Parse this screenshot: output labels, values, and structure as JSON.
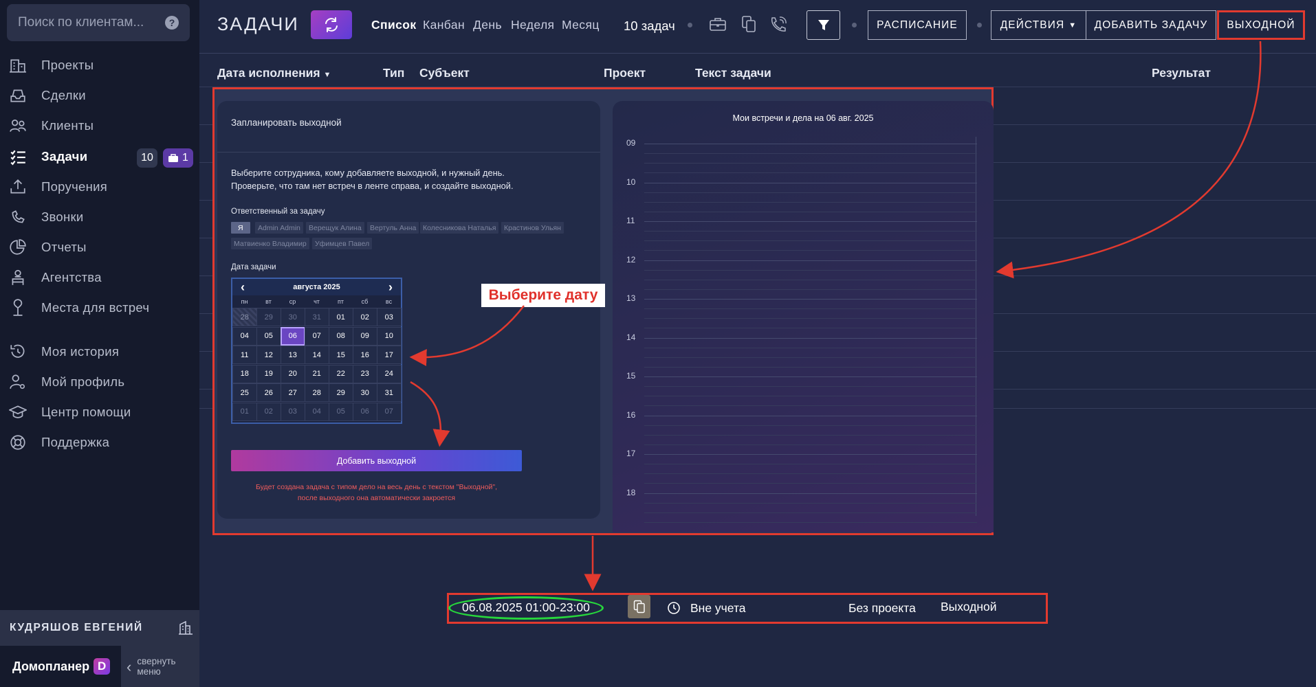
{
  "sidebar": {
    "search_placeholder": "Поиск по клиентам...",
    "help_glyph": "?",
    "items": [
      {
        "label": "Проекты",
        "icon": "buildings-icon"
      },
      {
        "label": "Сделки",
        "icon": "inbox-icon"
      },
      {
        "label": "Клиенты",
        "icon": "users-icon"
      },
      {
        "label": "Задачи",
        "icon": "task-list-icon",
        "active": true
      },
      {
        "label": "Поручения",
        "icon": "upload-tray-icon"
      },
      {
        "label": "Звонки",
        "icon": "phone-icon"
      },
      {
        "label": "Отчеты",
        "icon": "pie-chart-icon"
      },
      {
        "label": "Агентства",
        "icon": "agency-icon"
      },
      {
        "label": "Места для встреч",
        "icon": "location-icon"
      },
      {
        "label": "Моя история",
        "icon": "history-icon"
      },
      {
        "label": "Мой профиль",
        "icon": "user-settings-icon"
      },
      {
        "label": "Центр помощи",
        "icon": "graduation-cap-icon"
      },
      {
        "label": "Поддержка",
        "icon": "lifebuoy-icon"
      }
    ],
    "tasks_count": "10",
    "tasks_brief_count": "1",
    "user_name": "КУДРЯШОВ ЕВГЕНИЙ",
    "brand": "Домопланер",
    "brand_logo": "D",
    "collapse_line1": "свернуть",
    "collapse_line2": "меню"
  },
  "topbar": {
    "title": "ЗАДАЧИ",
    "tabs": [
      "Список",
      "Канбан",
      "День",
      "Неделя",
      "Месяц"
    ],
    "active_tab": "Список",
    "task_count": "10 задач",
    "schedule_btn": "РАСПИСАНИЕ",
    "actions_btn": "ДЕЙСТВИЯ",
    "add_task_btn": "ДОБАВИТЬ ЗАДАЧУ",
    "day_off_btn": "ВЫХОДНОЙ"
  },
  "table": {
    "columns": [
      "Дата исполнения",
      "Тип",
      "Субъект",
      "Проект",
      "Текст задачи",
      "Результат"
    ]
  },
  "modal": {
    "title": "Запланировать выходной",
    "desc1": "Выберите сотрудника, кому добавляете выходной, и нужный день.",
    "desc2": "Проверьте, что там нет встреч в ленте справа, и создайте выходной.",
    "responsible_label": "Ответственный за задачу",
    "employees": [
      "Я",
      "Admin Admin",
      "Верещук Алина",
      "Вертуль Анна",
      "Колесникова Наталья",
      "Крастинов Ульян",
      "Матвиенко Владимир",
      "Уфимцев Павел"
    ],
    "date_label": "Дата задачи",
    "calendar": {
      "month": "августа 2025",
      "dow": [
        "пн",
        "вт",
        "ср",
        "чт",
        "пт",
        "сб",
        "вс"
      ],
      "weeks": [
        [
          "28",
          "29",
          "30",
          "31",
          "01",
          "02",
          "03"
        ],
        [
          "04",
          "05",
          "06",
          "07",
          "08",
          "09",
          "10"
        ],
        [
          "11",
          "12",
          "13",
          "14",
          "15",
          "16",
          "17"
        ],
        [
          "18",
          "19",
          "20",
          "21",
          "22",
          "23",
          "24"
        ],
        [
          "25",
          "26",
          "27",
          "28",
          "29",
          "30",
          "31"
        ],
        [
          "01",
          "02",
          "03",
          "04",
          "05",
          "06",
          "07"
        ]
      ],
      "selected": "06"
    },
    "add_button": "Добавить выходной",
    "note1": "Будет создана задача с типом дело на весь день с текстом \"Выходной\",",
    "note2": "после выходного она автоматически закроется",
    "schedule_title": "Мои встречи и дела на 06 авг. 2025",
    "hours": [
      "09",
      "10",
      "11",
      "12",
      "13",
      "14",
      "15",
      "16",
      "17",
      "18"
    ]
  },
  "callout": "Выберите дату",
  "result": {
    "date": "06.08.2025 01:00-23:00",
    "type": "Вне учета",
    "project": "Без проекта",
    "text": "Выходной"
  },
  "colors": {
    "accent_red": "#e23a2f",
    "highlight_green": "#27d63c",
    "purple": "#6a46c2"
  }
}
